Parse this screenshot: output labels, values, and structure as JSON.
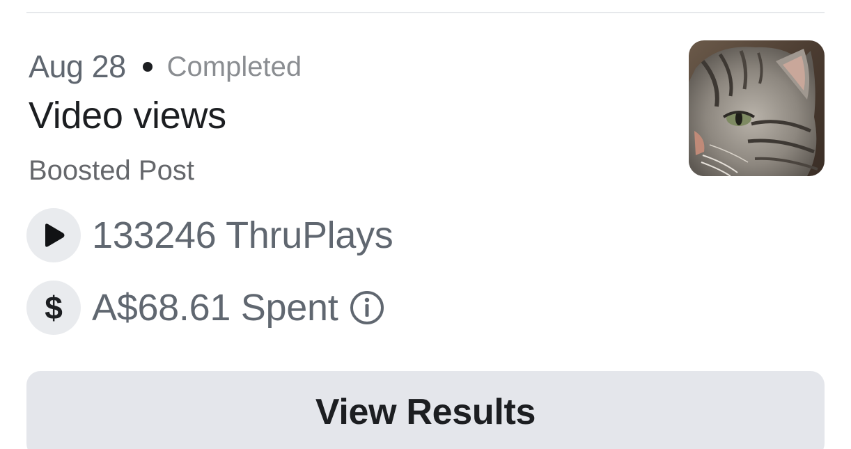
{
  "campaign": {
    "date": "Aug 28",
    "status": "Completed",
    "objective": "Video views",
    "type": "Boosted Post",
    "thumbnail_icon": "cat-photo"
  },
  "stats": {
    "thruplays_text": "133246 ThruPlays",
    "thruplays_icon": "play-icon",
    "spent_text": "A$68.61 Spent",
    "spent_icon": "dollar-icon",
    "spent_symbol": "$",
    "info_icon": "info-icon"
  },
  "actions": {
    "view_results_label": "View Results"
  },
  "colors": {
    "button_bg": "#e4e6eb",
    "icon_bg": "#e9ebee",
    "primary_text": "#1c1e21",
    "secondary_text": "#606770",
    "divider": "#e6e8eb"
  }
}
